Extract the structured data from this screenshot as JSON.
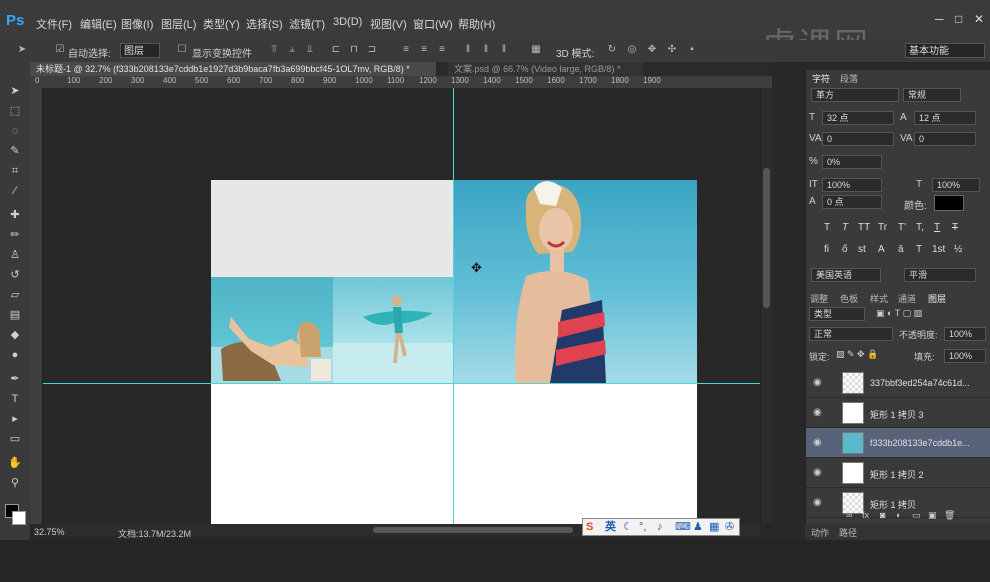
{
  "menu": [
    "文件(F)",
    "编辑(E)",
    "图像(I)",
    "图层(L)",
    "类型(Y)",
    "选择(S)",
    "滤镜(T)",
    "3D(D)",
    "视图(V)",
    "窗口(W)",
    "帮助(H)"
  ],
  "window_controls": {
    "minimize": "─",
    "maximize": "□",
    "close": "✕"
  },
  "options": {
    "auto_select_label": "自动选择:",
    "auto_select_value": "图层",
    "show_transform_label": "显示变换控件",
    "mode_3d_label": "3D 模式:",
    "workspace_value": "基本功能"
  },
  "tabs": [
    {
      "label": "未标题-1 @ 32.7% (f333b208133e7cddb1e1927d3b9baca7fb3a699bbcf45-1OL7mv, RGB/8) *",
      "active": true
    },
    {
      "label": "文案.psd @ 66.7% (Video large, RGB/8) *",
      "active": false
    }
  ],
  "ruler_labels": [
    "0",
    "100",
    "200",
    "300",
    "400",
    "500",
    "600",
    "700",
    "800",
    "900",
    "1000",
    "1100",
    "1200",
    "1300",
    "1400",
    "1500",
    "1600",
    "1700",
    "1800",
    "1900"
  ],
  "status": {
    "zoom": "32.75%",
    "doc": "文档:13.7M/23.2M"
  },
  "ime": {
    "label": "英"
  },
  "character_panel": {
    "tabs": [
      "字符",
      "段落"
    ],
    "font_family": "革方",
    "font_style": "常规",
    "font_size": "32 点",
    "leading": "12 点",
    "kerning": "0",
    "tracking": "0",
    "scale_percent": "0%",
    "vertical_scale": "100%",
    "horizontal_scale": "100%",
    "baseline_shift": "0 点",
    "color_label": "颜色:",
    "style_buttons": [
      "T",
      "T",
      "TT",
      "Tr",
      "T'",
      "T,",
      "T",
      "T"
    ],
    "ot_buttons": [
      "fi",
      "ő",
      "st",
      "A",
      "ā",
      "T",
      "1st",
      "½"
    ],
    "language": "美国英语",
    "antialias": "平滑"
  },
  "layers_panel": {
    "tabs": [
      "调整",
      "色板",
      "样式",
      "通道",
      "图层"
    ],
    "filter_kind": "类型",
    "blend_mode": "正常",
    "opacity_label": "不透明度:",
    "opacity_value": "100%",
    "lock_label": "锁定:",
    "fill_label": "填充:",
    "fill_value": "100%",
    "layers": [
      {
        "name": "337bbf3ed254a74c61d...",
        "selected": false
      },
      {
        "name": "矩形 1 拷贝 3",
        "selected": false
      },
      {
        "name": "f333b208133e7cddb1e...",
        "selected": true
      },
      {
        "name": "矩形 1 拷贝 2",
        "selected": false
      },
      {
        "name": "矩形 1 拷贝",
        "selected": false
      }
    ],
    "bottom_tabs": [
      "动作",
      "路径"
    ]
  },
  "watermark": "虎课网"
}
